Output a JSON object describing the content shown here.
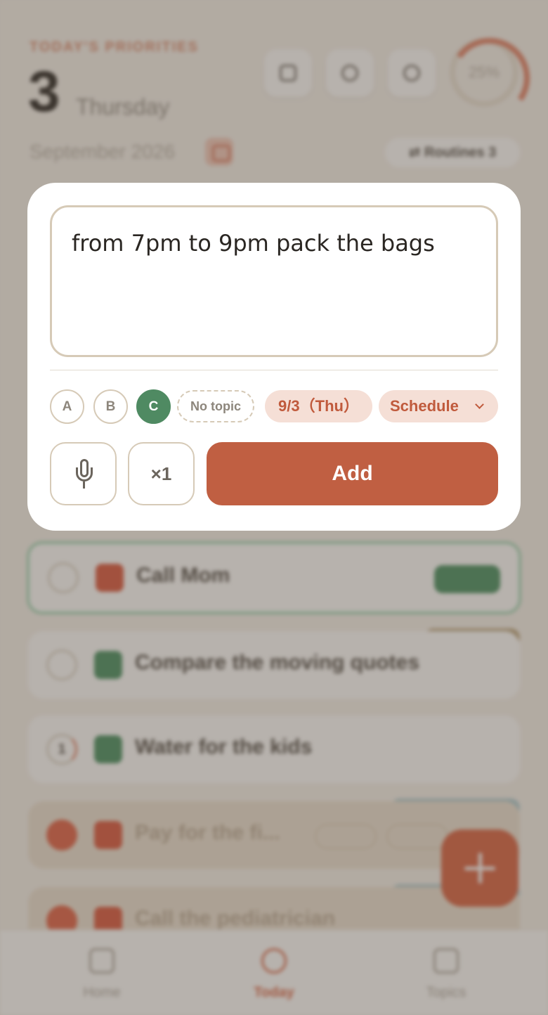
{
  "background": {
    "eyebrow": "TODAY'S PRIORITIES",
    "day_number": "3",
    "day_name": "Thursday",
    "month_year": "September 2026",
    "progress": "25%",
    "routines": "⇄ Routines 3",
    "tasks": [
      {
        "title": "Call Mom"
      },
      {
        "title": "Compare the moving quotes"
      },
      {
        "title": "Water for the kids",
        "count": "1"
      },
      {
        "title": "Pay for the fi..."
      },
      {
        "title": "Call the pediatrician"
      }
    ],
    "tabs": [
      "Home",
      "Today",
      "Topics"
    ],
    "accent": "#d75b3a"
  },
  "composer": {
    "text": "from 7pm to 9pm pack the bags",
    "priorities": [
      "A",
      "B",
      "C"
    ],
    "selected_priority": "C",
    "topic": "No topic",
    "date": "9/3（Thu）",
    "schedule": "Schedule",
    "multiplier": "×1",
    "add": "Add",
    "colors": {
      "primary": "#c05f42",
      "priority_c": "#4f8a62",
      "chip_bg": "#f5dfd6"
    }
  }
}
